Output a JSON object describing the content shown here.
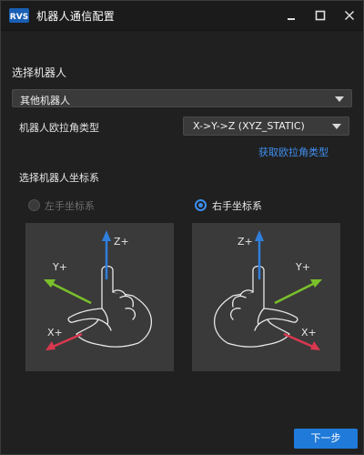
{
  "window": {
    "title": "机器人通信配置"
  },
  "robot": {
    "section_title": "选择机器人",
    "selected": "其他机器人"
  },
  "euler": {
    "label": "机器人欧拉角类型",
    "selected": "X->Y->Z (XYZ_STATIC)",
    "get_link": "获取欧拉角类型"
  },
  "coord": {
    "section_title": "选择机器人坐标系",
    "left_label": "左手坐标系",
    "right_label": "右手坐标系",
    "left_selected": false,
    "right_selected": true,
    "left_axes": {
      "z": "Z+",
      "y": "Y+",
      "x": "X+"
    },
    "right_axes": {
      "z": "Z+",
      "y": "Y+",
      "x": "X+"
    }
  },
  "footer": {
    "next_label": "下一步"
  },
  "colors": {
    "accent": "#1f7ad9",
    "axis_z": "#2f7fdc",
    "axis_y": "#7ac02a",
    "axis_x": "#d9384f"
  },
  "icons": {
    "app_logo": "rvs-logo-icon",
    "minimize": "minimize-icon",
    "maximize": "maximize-icon",
    "close": "close-icon",
    "dropdown": "chevron-down-icon"
  }
}
